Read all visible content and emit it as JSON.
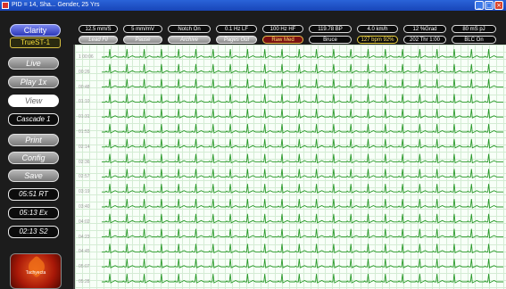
{
  "window": {
    "title": "PID = 14, Sha... Gender, 25 Yrs",
    "minimize_glyph": "_",
    "maximize_glyph": "□",
    "close_glyph": "×"
  },
  "left_panel": {
    "logo": "Clarity",
    "model": "TrueST-1",
    "nav": [
      {
        "label": "Live"
      },
      {
        "label": "Play 1x"
      },
      {
        "label": "View"
      },
      {
        "label": "Cascade 1"
      },
      {
        "label": "Print"
      },
      {
        "label": "Config"
      },
      {
        "label": "Save"
      }
    ],
    "info": [
      {
        "label": "05:51 RT"
      },
      {
        "label": "05:13 Ex"
      },
      {
        "label": "02:13 S2"
      }
    ],
    "tachy_logo_text": "Tachyecta"
  },
  "toolbar": {
    "row1": [
      "12.5 mm/S",
      "5 mm/mV",
      "Notch On",
      "0.1 Hz LF",
      "100 Hz HF",
      "119.78 BP",
      "4.0 km/h",
      "12 %Grad",
      "80 mS pJ"
    ],
    "row2": [
      "Lead Fil",
      "Pause",
      "Archive",
      "Pages Out",
      "Raw Med",
      "Bruce",
      "127 bpm 92%",
      "202 Thr 1:00",
      "BLC On"
    ]
  },
  "ecg": {
    "times": [
      "1 00:06",
      "00:26",
      "00:48",
      "01:10",
      "01:31",
      "01:53",
      "02:14",
      "02:36",
      "02:57",
      "03:19",
      "03:40",
      "04:02",
      "04:23",
      "04:45",
      "05:07",
      "05:28"
    ],
    "trace_color": "#2a9a2a",
    "grid_color": "#d4ecd4"
  }
}
